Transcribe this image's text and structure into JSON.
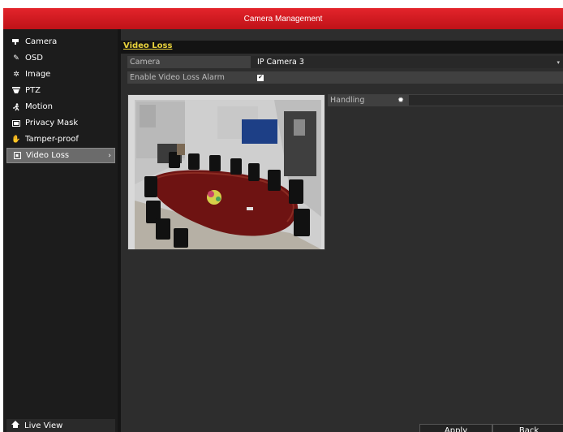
{
  "window": {
    "title": "Camera Management"
  },
  "sidebar": {
    "items": [
      {
        "label": "Camera",
        "icon": "camera-icon"
      },
      {
        "label": "OSD",
        "icon": "pencil-icon"
      },
      {
        "label": "Image",
        "icon": "brightness-icon"
      },
      {
        "label": "PTZ",
        "icon": "ptz-icon"
      },
      {
        "label": "Motion",
        "icon": "running-person-icon"
      },
      {
        "label": "Privacy Mask",
        "icon": "mask-icon"
      },
      {
        "label": "Tamper-proof",
        "icon": "hand-icon"
      },
      {
        "label": "Video Loss",
        "icon": "video-loss-icon",
        "active": true
      }
    ],
    "live_view_label": "Live View"
  },
  "main": {
    "tab_label": "Video Loss",
    "camera": {
      "label": "Camera",
      "value": "IP Camera 3"
    },
    "enable_alarm": {
      "label": "Enable Video Loss Alarm",
      "checked": true
    },
    "handling": {
      "label": "Handling"
    }
  },
  "buttons": {
    "apply": "Apply",
    "back": "Back"
  },
  "colors": {
    "titlebar": "#d31c22",
    "tab_accent": "#e8d23c",
    "active_item": "#6b6b6b"
  }
}
